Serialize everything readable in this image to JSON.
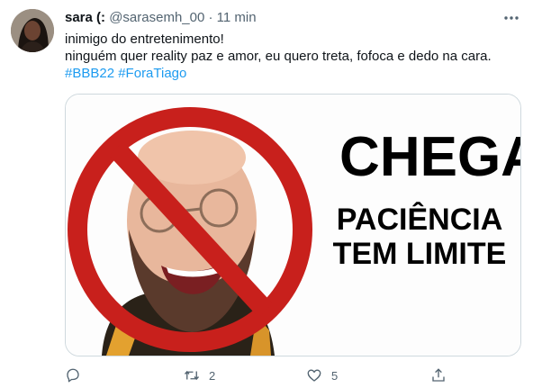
{
  "tweet": {
    "author_name": "sara (:",
    "handle": "@sarasemh_00",
    "separator": "·",
    "time": "11 min",
    "line1": "inimigo do entretenimento!",
    "line2": " ninguém quer reality paz e amor, eu quero treta, fofoca e dedo na cara.",
    "hashtag1": "#BBB22",
    "hashtag2": "#ForaTiago"
  },
  "media": {
    "headline": "CHEGA",
    "subline1": "PACIÊNCIA",
    "subline2": "TEM LIMITE"
  },
  "actions": {
    "reply_count": "",
    "retweet_count": "2",
    "like_count": "5"
  },
  "colors": {
    "accent": "#1d9bf0",
    "muted": "#536471",
    "prohibition_red": "#c8201c"
  },
  "icons": [
    "more-icon",
    "reply-icon",
    "retweet-icon",
    "like-icon",
    "share-icon"
  ]
}
